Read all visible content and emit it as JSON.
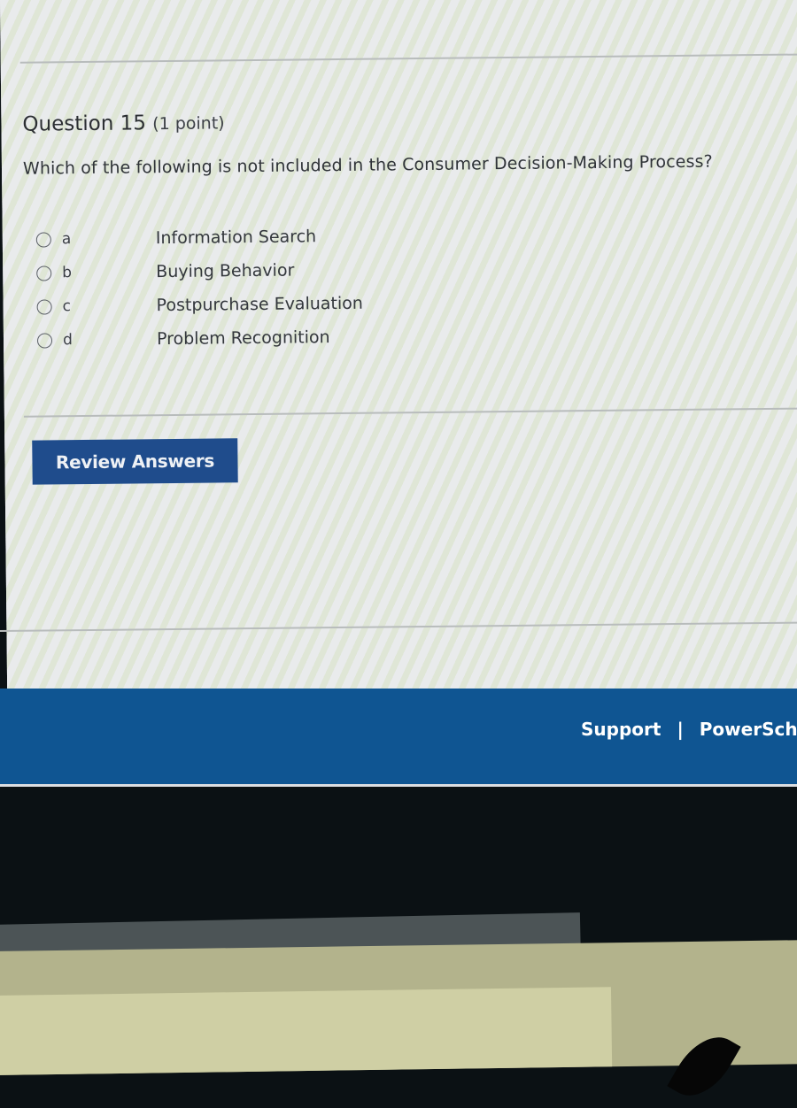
{
  "quiz": {
    "question_label": "Question 15",
    "points": "(1 point)",
    "question_text": "Which of the  following is not included in the Consumer Decision-Making Process?",
    "options": [
      {
        "letter": "a",
        "text": "Information Search",
        "selected": false
      },
      {
        "letter": "b",
        "text": "Buying Behavior",
        "selected": false
      },
      {
        "letter": "c",
        "text": "Postpurchase Evaluation",
        "selected": false
      },
      {
        "letter": "d",
        "text": "Problem Recognition",
        "selected": false
      }
    ],
    "review_button": "Review Answers"
  },
  "footer": {
    "support_link": "Support",
    "separator": "|",
    "brand_link": "PowerSch"
  },
  "colors": {
    "button_bg": "#1f4c8c",
    "footer_bg": "#0f5592"
  }
}
